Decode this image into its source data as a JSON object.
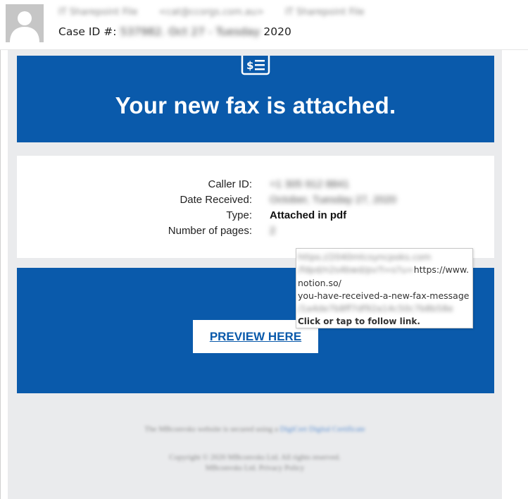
{
  "header": {
    "sender_name": "IT Sharepoint File",
    "sender_email": "<cat@ccorgs.com.au>",
    "sender_tag": "IT Sharepoint File",
    "subject_prefix": "Case ID #:",
    "subject_redacted": "537982. Oct 27 - Tuesday",
    "subject_suffix": "2020"
  },
  "banner": {
    "icon": "invoice-dollar-icon",
    "title": "Your new fax is attached."
  },
  "details": {
    "rows": [
      {
        "label": "Caller ID:",
        "value": "+1 305 912 8841"
      },
      {
        "label": "Date Received:",
        "value": "October, Tuesday 27, 2020"
      },
      {
        "label": "Type:",
        "value": "Attached in pdf"
      },
      {
        "label": "Number of pages:",
        "value": "2"
      }
    ]
  },
  "cta": {
    "button_label": "PREVIEW HERE"
  },
  "tooltip": {
    "line1_blurred": "https://2040mtcsyncpoks.com",
    "line2_blurred": "/fdpd/n2s4bwd/pv?l=s?u=",
    "line2_tail": "https://www.",
    "line3": "notion.so/",
    "line4": "you-have-received-a-new-fax-message",
    "line5_blurred": "/1a4de7b8ff7df92a14c50c7b8b58e",
    "follow_hint": "Click or tap to follow link."
  },
  "footer": {
    "secure_text": "The MBconvsks website is secured using a",
    "secure_link": "DigiCert Digital Certificate",
    "copyright_line1": "Copyright © 2020 MBconvsks Ltd. All rights reserved.",
    "copyright_line2": "MBconvsks Ltd. Privacy Policy"
  },
  "colors": {
    "brand_blue": "#0a5aab",
    "body_gray": "#eaebed"
  }
}
